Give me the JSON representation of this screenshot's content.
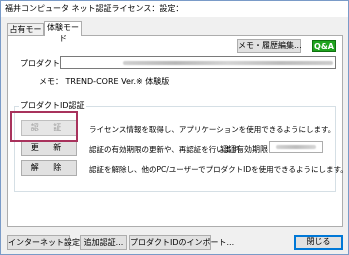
{
  "window": {
    "title": "福井コンピュータ ネット認証ライセンス：設定："
  },
  "tabs": [
    {
      "label": "占有モード"
    },
    {
      "label": "体験モード"
    }
  ],
  "panel": {
    "memo_button": "メモ・履歴編集...",
    "qa_label": "Q&A",
    "product_id_label": "プロダクトID：",
    "memo_text": "メモ： TREND-CORE Ver.※ 体験版"
  },
  "auth_group": {
    "title": "プロダクトID認証",
    "buttons": [
      {
        "label": "認 証",
        "enabled": false,
        "desc": "ライセンス情報を取得し、アプリケーションを使用できるようにします。"
      },
      {
        "label": "更 新",
        "enabled": true,
        "desc": "認証の有効期限の更新や、再認証を行います。"
      },
      {
        "label": "解 除",
        "enabled": true,
        "desc": "認証を解除し、他のPC/ユーザーでプロダクトIDを使用できるようにします。"
      }
    ],
    "validity_label": "認証有効期限"
  },
  "bottom_bar": {
    "internet_settings": "インターネット設定...",
    "add_auth": "追加認証...",
    "import_pid": "プロダクトIDのインポート...",
    "close": "閉じる"
  },
  "colors": {
    "highlight": "#a8325c",
    "qa_green": "#1ea31e",
    "focus_blue": "#0078d7"
  }
}
